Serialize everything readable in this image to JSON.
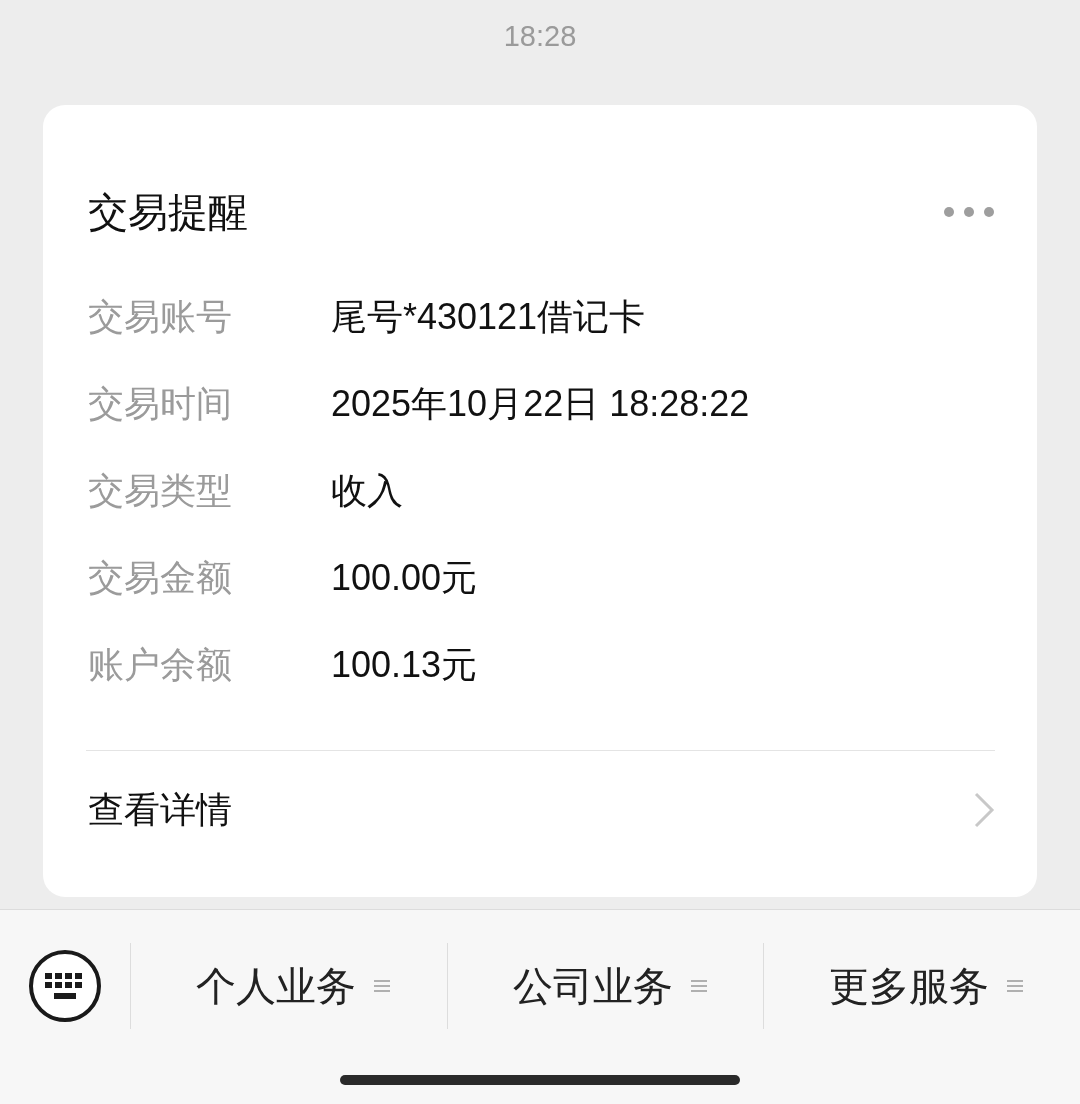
{
  "status_bar": {
    "time": "18:28"
  },
  "card": {
    "title": "交易提醒",
    "fields": [
      {
        "label": "交易账号",
        "value": "尾号*430121借记卡"
      },
      {
        "label": "交易时间",
        "value": "2025年10月22日 18:28:22"
      },
      {
        "label": "交易类型",
        "value": "收入"
      },
      {
        "label": "交易金额",
        "value": "100.00元"
      },
      {
        "label": "账户余额",
        "value": "100.13元"
      }
    ],
    "link": "查看详情"
  },
  "menu_bar": {
    "items": [
      {
        "label": "个人业务"
      },
      {
        "label": "公司业务"
      },
      {
        "label": "更多服务"
      }
    ]
  }
}
